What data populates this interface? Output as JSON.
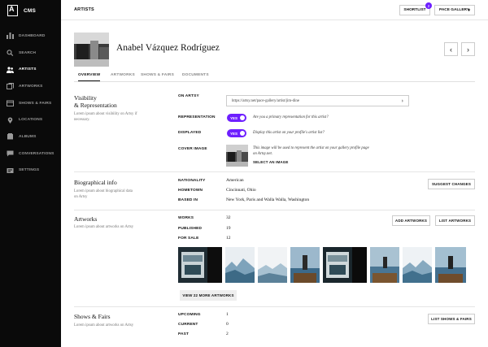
{
  "app": {
    "logo_text": "CMS",
    "page": "ARTISTS"
  },
  "sidebar": {
    "items": [
      {
        "label": "DASHBOARD",
        "icon": "bar-chart-icon"
      },
      {
        "label": "SEARCH",
        "icon": "search-icon"
      },
      {
        "label": "ARTISTS",
        "icon": "users-icon",
        "active": true
      },
      {
        "label": "ARTWORKS",
        "icon": "artworks-icon"
      },
      {
        "label": "SHOWS & FAIRS",
        "icon": "calendar-icon"
      },
      {
        "label": "LOCATIONS",
        "icon": "location-pin-icon"
      },
      {
        "label": "ALBUMS",
        "icon": "album-icon"
      },
      {
        "label": "CONVERSATIONS",
        "icon": "chat-icon"
      },
      {
        "label": "SETTINGS",
        "icon": "settings-icon"
      }
    ]
  },
  "header": {
    "shortlist_label": "SHORTLIST",
    "shortlist_count": "2",
    "gallery": "PACE GALLERY",
    "gallery_caret": "▾"
  },
  "artist": {
    "name": "Anabel Vázquez Rodríguez",
    "prev": "‹",
    "next": "›"
  },
  "tabs": [
    "OVERVIEW",
    "ARTWORKS",
    "SHOWS & FAIRS",
    "DOCUMENTS"
  ],
  "visibility": {
    "title_line1": "Visibility",
    "title_line2": "& Representation",
    "desc": "Lorem ipsum about visibility on Artsy if necessary.",
    "on_artsy_label": "ON ARTSY",
    "url": "https://artsy.net/pace-gallery/artist/jim-dine",
    "url_go": "›",
    "representation_label": "REPRESENTATION",
    "representation_toggle": "YES",
    "representation_hint": "Are you a primary representation for this artist?",
    "displayed_label": "DISPLAYED",
    "displayed_toggle": "YES",
    "displayed_hint": "Display this artist on your profile's artist list?",
    "cover_label": "COVER IMAGE",
    "cover_hint_line1": "This image will be used to represent the artist on your gallery profile page",
    "cover_hint_line2": "on Artsy.net.",
    "select_image": "SELECT AN IMAGE"
  },
  "bio": {
    "title": "Biographical info",
    "desc": "Lorem ipsum about biographical data on Artsy",
    "nationality_label": "NATIONALITY",
    "nationality": "American",
    "hometown_label": "HOMETOWN",
    "hometown": "Cincinnati, Ohio",
    "based_label": "BASED IN",
    "based": "New York, Paris and Walla Walla, Washington",
    "suggest_button": "SUGGEST CHANGES"
  },
  "artworks": {
    "title": "Artworks",
    "desc": "Lorem ipsum about artworks on Artsy",
    "works_label": "WORKS",
    "works": "32",
    "published_label": "PUBLISHED",
    "published": "19",
    "for_sale_label": "FOR SALE",
    "for_sale": "12",
    "add_button": "ADD ARTWORKS",
    "list_button": "LIST ARTWORKS",
    "view_more": "VIEW 22 MORE ARTWORKS"
  },
  "shows": {
    "title": "Shows & Fairs",
    "desc": "Lorem ipsum about artworks on Artsy",
    "upcoming_label": "UPCOMING",
    "upcoming": "1",
    "current_label": "CURRENT",
    "current": "0",
    "past_label": "PAST",
    "past": "2",
    "list_button": "LIST SHOWS & FAIRS"
  },
  "colors": {
    "accent": "#6e1fff",
    "sidebar": "#0a0a0a"
  }
}
